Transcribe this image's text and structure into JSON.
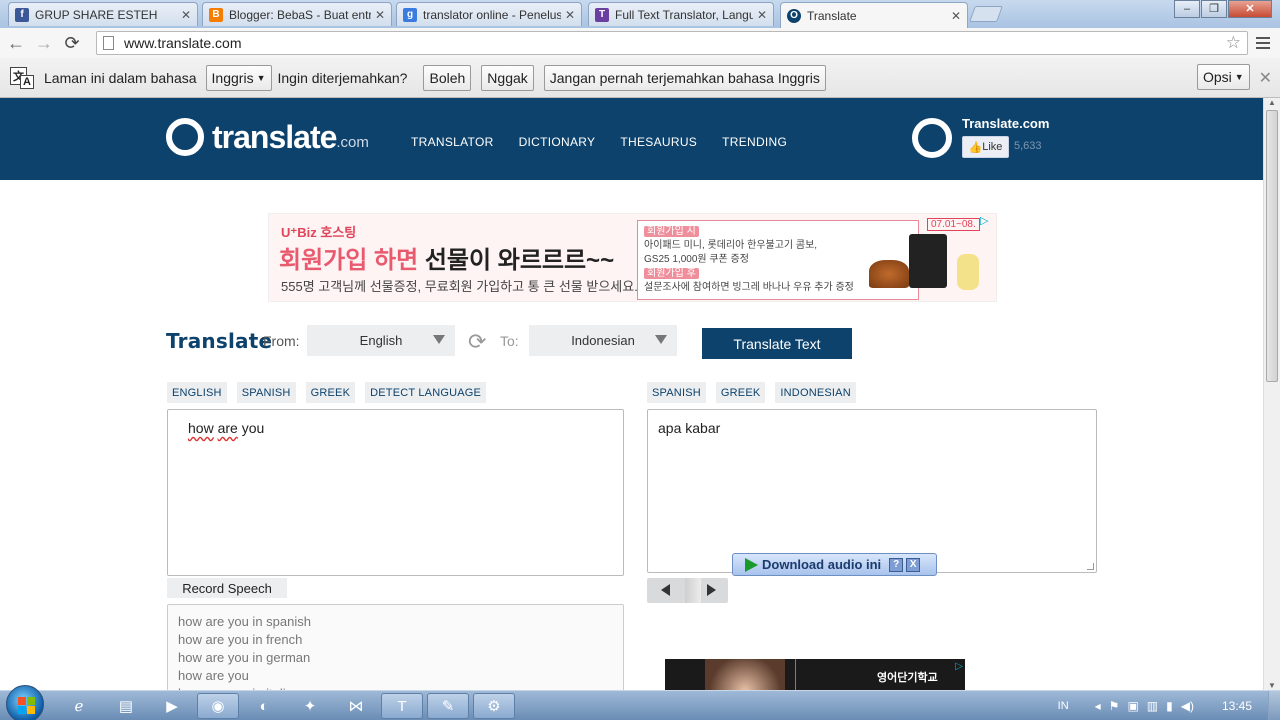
{
  "browser": {
    "tabs": [
      {
        "title": "GRUP SHARE ESTEH",
        "icon": "facebook-icon",
        "color": "#3b5998",
        "glyph": "f"
      },
      {
        "title": "Blogger: BebaS - Buat entri",
        "icon": "blogger-icon",
        "color": "#f57d00",
        "glyph": "B"
      },
      {
        "title": "translator online - Penelusu",
        "icon": "google-icon",
        "color": "#3a7be0",
        "glyph": "g"
      },
      {
        "title": "Full Text Translator, Langu",
        "icon": "translator-icon",
        "color": "#6b3fa0",
        "glyph": "T"
      },
      {
        "title": "Translate",
        "icon": "translate-com-icon",
        "color": "#0d426c",
        "glyph": "O",
        "active": true
      }
    ],
    "url": "www.translate.com"
  },
  "infobar": {
    "text1": "Laman ini dalam bahasa",
    "lang_select": "Inggris",
    "text2": "Ingin diterjemahkan?",
    "yes": "Boleh",
    "no": "Nggak",
    "never": "Jangan pernah terjemahkan bahasa Inggris",
    "options": "Opsi",
    "icon_glyph1": "文",
    "icon_glyph2": "A"
  },
  "site": {
    "logo_word": "translate",
    "logo_domain": ".com",
    "nav": [
      "TRANSLATOR",
      "DICTIONARY",
      "THESAURUS",
      "TRENDING"
    ],
    "fb_name": "Translate.com",
    "fb_like": "Like",
    "fb_count": "5,633"
  },
  "ad_banner": {
    "brand": "U⁺Biz 호스팅",
    "headline_pink": "회원가입 하면 ",
    "headline_dark": "선물이 와르르르~~",
    "sub": "555명 고객님께 선물증정, 무료회원 가입하고 통 큰 선물 받으세요.",
    "box_tag1": "회원가입 시",
    "box_line1": "아이패드 미니, 롯데리아 한우불고기 콤보,",
    "box_line2": "GS25 1,000원 쿠폰 증정",
    "box_tag2": "회원가입 후",
    "box_line3": "설문조사에 참여하면 빙그레 바나나 우유 추가 증정",
    "date": "07.01~08."
  },
  "translator": {
    "title": "Translate",
    "from_label": "From:",
    "from_value": "English",
    "to_label": "To:",
    "to_value": "Indonesian",
    "button": "Translate Text",
    "source_chips": [
      "ENGLISH",
      "SPANISH",
      "GREEK",
      "DETECT LANGUAGE"
    ],
    "target_chips": [
      "SPANISH",
      "GREEK",
      "INDONESIAN"
    ],
    "source_words": [
      "how",
      "are",
      "you"
    ],
    "target_text": "apa kabar",
    "record": "Record Speech",
    "download_audio": "Download audio ini",
    "help": "?",
    "close": "X",
    "suggestions": [
      "how are you in spanish",
      "how are you in french",
      "how are you in german",
      "how are you",
      "how are you in italian"
    ]
  },
  "ad2": {
    "text": "영어단기학교"
  },
  "taskbar": {
    "lang": "IN",
    "time": "13:45",
    "apps": [
      "ie-icon",
      "explorer-icon",
      "media-player-icon",
      "chrome-icon",
      "firefox-icon",
      "app-icon",
      "vs-icon",
      "translator-app-icon",
      "paint-icon",
      "tool-icon"
    ]
  }
}
